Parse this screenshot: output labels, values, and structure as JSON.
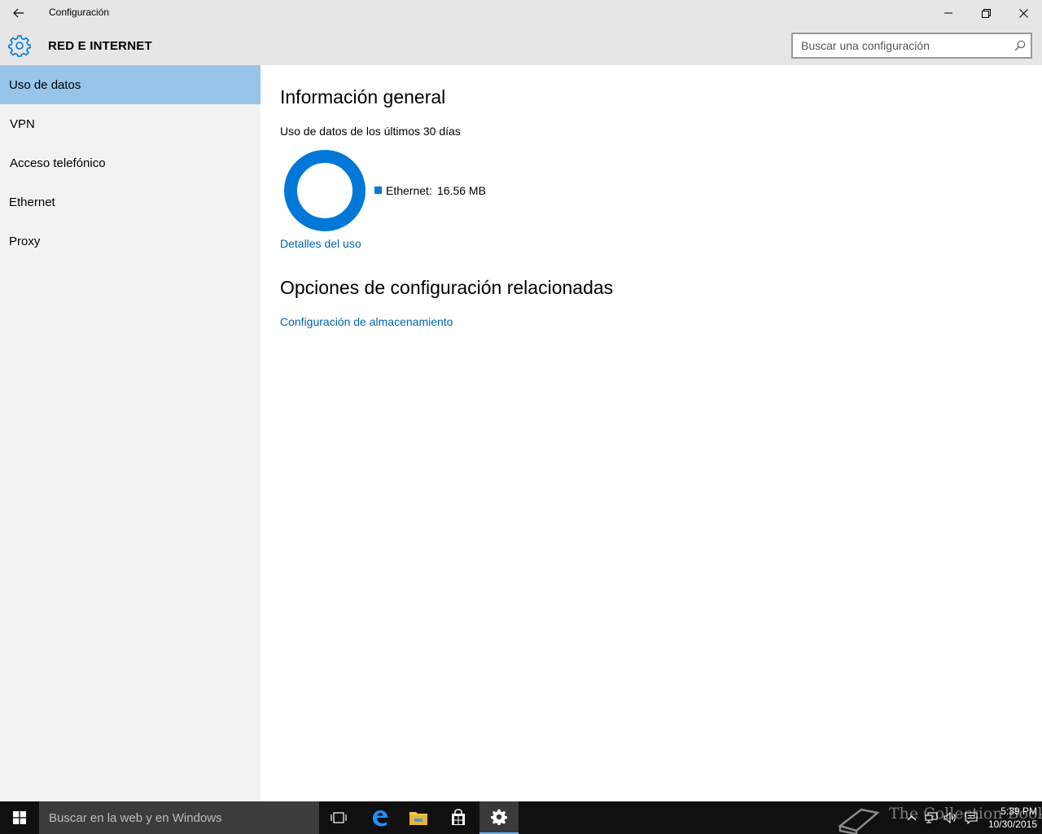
{
  "window": {
    "title": "Configuración"
  },
  "header": {
    "section_title": "RED E INTERNET",
    "search_placeholder": "Buscar una configuración"
  },
  "sidebar": {
    "items": [
      {
        "label": "Uso de datos",
        "active": true
      },
      {
        "label": "VPN",
        "active": false
      },
      {
        "label": "Acceso telefónico",
        "active": false
      },
      {
        "label": "Ethernet",
        "active": false
      },
      {
        "label": "Proxy",
        "active": false
      }
    ]
  },
  "main": {
    "overview_heading": "Información general",
    "usage_subtitle": "Uso de datos de los últimos 30 días",
    "usage_legend_label": "Ethernet:",
    "usage_legend_value": "16.56 MB",
    "usage_details_link": "Detalles del uso",
    "related_heading": "Opciones de configuración relacionadas",
    "storage_link": "Configuración de almacenamiento"
  },
  "colors": {
    "accent": "#0078d7",
    "link": "#0063b1",
    "sidebar_active": "#99c4e9",
    "chrome": "#e6e6e6",
    "sidebar_bg": "#f2f2f2",
    "taskbar": "#101010"
  },
  "taskbar": {
    "search_placeholder": "Buscar en la web y en Windows",
    "watermark": "The Collection Book",
    "time": "5:39 PM",
    "date": "10/30/2015"
  },
  "icons": {
    "back": "back-arrow-icon",
    "settings": "gear-icon",
    "search": "search-icon",
    "start": "windows-logo-icon",
    "task_view": "task-view-icon",
    "edge": "edge-icon",
    "explorer": "folder-icon",
    "store": "store-icon"
  }
}
